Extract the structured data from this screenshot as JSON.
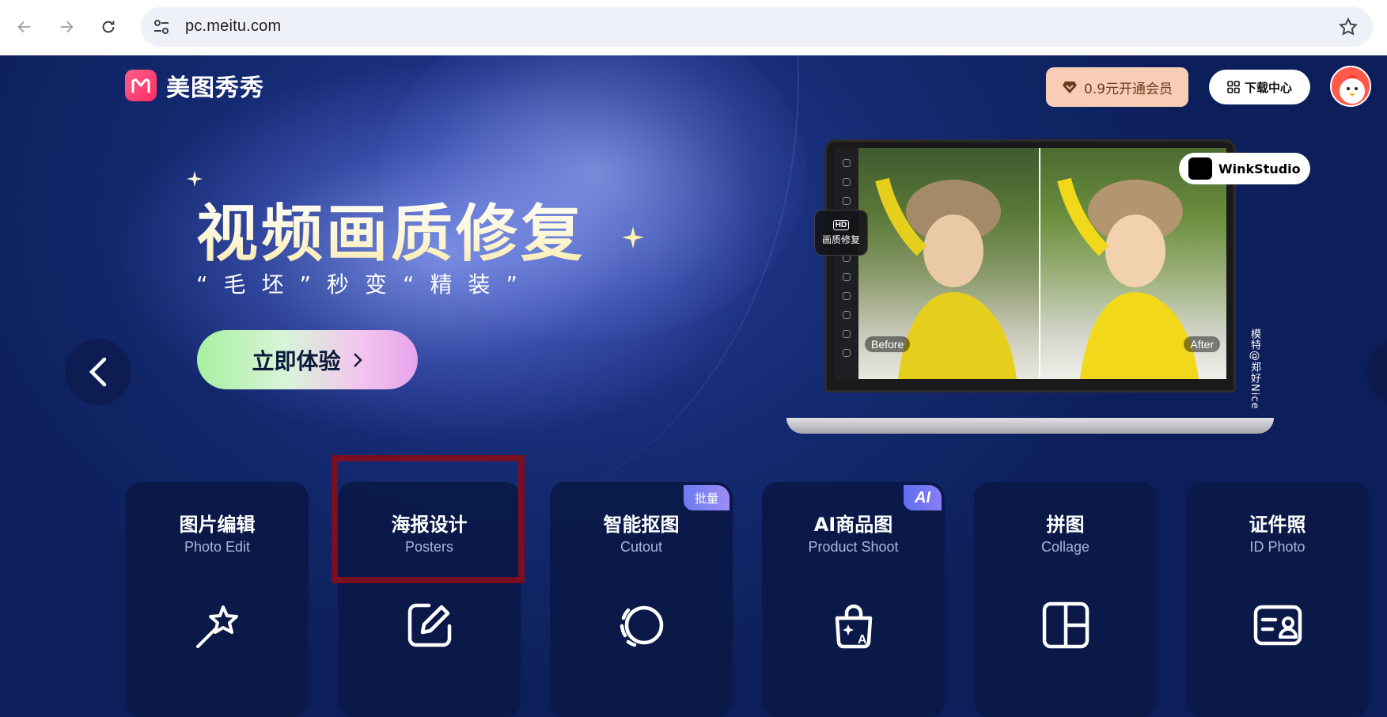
{
  "browser": {
    "url": "pc.meitu.com"
  },
  "header": {
    "logo_text": "美图秀秀",
    "vip_button": "0.9元开通会员",
    "download_button": "下载中心"
  },
  "hero": {
    "title": "视频画质修复",
    "subtitle": "“毛坯”秒变“精装”",
    "cta_label": "立即体验",
    "hd_badge": "画质修复",
    "hd_label": "HD",
    "brand_badge": "WinkStudio",
    "before_label": "Before",
    "after_label": "After",
    "credit": "模特@郑好Nice"
  },
  "cards": [
    {
      "title": "图片编辑",
      "subtitle": "Photo Edit",
      "icon": "magic-wand-icon"
    },
    {
      "title": "海报设计",
      "subtitle": "Posters",
      "icon": "edit-square-icon"
    },
    {
      "title": "智能抠图",
      "subtitle": "Cutout",
      "icon": "cutout-circle-icon",
      "badge": "批量"
    },
    {
      "title": "AI商品图",
      "subtitle": "Product Shoot",
      "icon": "ai-bag-icon",
      "badge": "AI"
    },
    {
      "title": "拼图",
      "subtitle": "Collage",
      "icon": "collage-grid-icon"
    },
    {
      "title": "证件照",
      "subtitle": "ID Photo",
      "icon": "id-card-icon"
    }
  ],
  "colors": {
    "page_bg": "#0e2158",
    "vip_bg": "#f7cdb5",
    "highlight_border": "#7a0f22"
  }
}
